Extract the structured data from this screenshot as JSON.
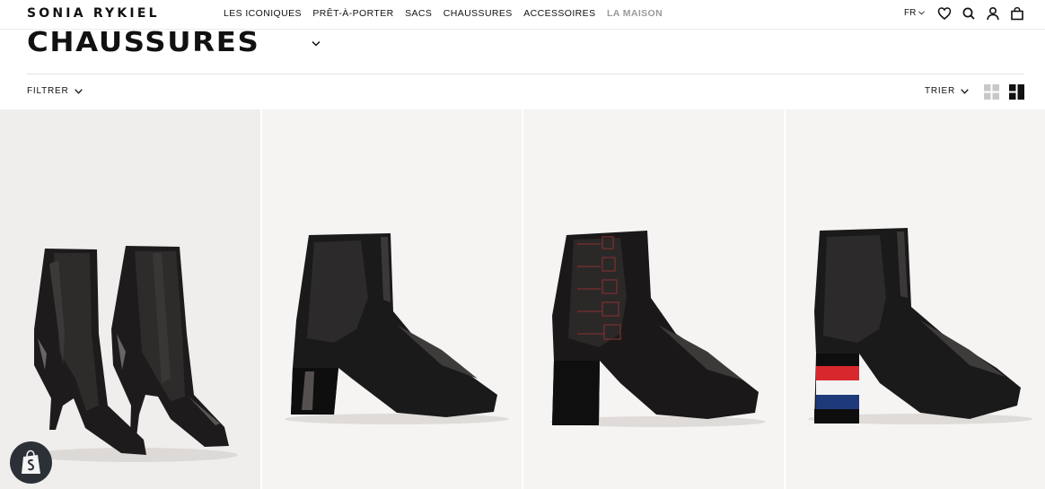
{
  "header": {
    "logo": "SONIA RYKIEL",
    "nav": [
      {
        "label": "LES ICONIQUES"
      },
      {
        "label": "PRÊT-À-PORTER"
      },
      {
        "label": "SACS"
      },
      {
        "label": "CHAUSSURES"
      },
      {
        "label": "ACCESSOIRES"
      },
      {
        "label": "LA MAISON"
      }
    ],
    "language": "FR",
    "icons": [
      "heart-icon",
      "search-icon",
      "account-icon",
      "bag-icon"
    ]
  },
  "page": {
    "title": "CHAUSSURES"
  },
  "toolbar": {
    "filter_label": "FILTRER",
    "sort_label": "TRIER",
    "view_options": [
      "grid-4-icon",
      "grid-mosaic-icon"
    ],
    "active_view": "grid-mosaic-icon"
  },
  "products": [
    {
      "image": "black pointed chelsea boot pair, stiletto heel"
    },
    {
      "image": "black leather ankle boot, patent block heel"
    },
    {
      "image": "black ankle boot with red RYKIEL stitching"
    },
    {
      "image": "black ankle boot with blue white red striped heel"
    }
  ],
  "colors": {
    "text": "#111111",
    "muted_nav": "#9a9a9a",
    "product_bg": "#f5f4f3",
    "accent_red": "#d8282e",
    "accent_blue": "#1f3a7a"
  },
  "widget": {
    "icon": "shopify-bag-icon"
  }
}
